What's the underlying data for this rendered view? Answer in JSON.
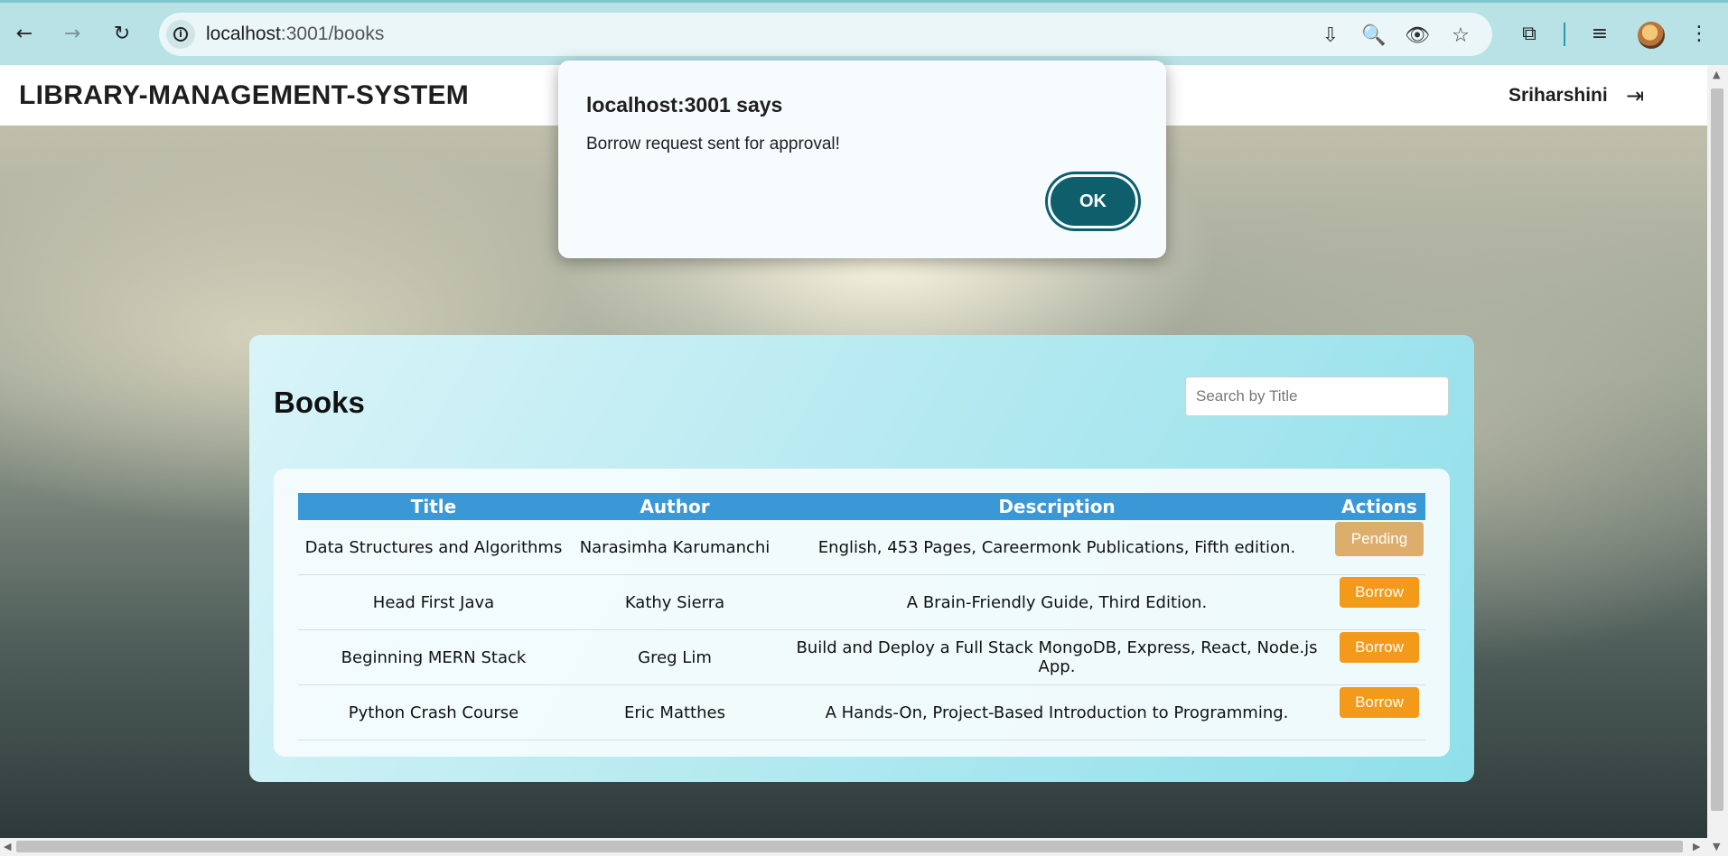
{
  "browser": {
    "url_host": "localhost",
    "url_path": ":3001/books",
    "icons": {
      "back": "←",
      "forward": "→",
      "reload": "↻",
      "install": "⇩",
      "zoom": "🔍",
      "eye": "👁",
      "star": "☆",
      "extensions": "⧉",
      "media": "≡",
      "menu": "⋮"
    }
  },
  "header": {
    "brand": "LIBRARY-MANAGEMENT-SYSTEM",
    "username": "Sriharshini",
    "logout_icon": "⇥"
  },
  "books": {
    "title": "Books",
    "search_placeholder": "Search by Title",
    "columns": [
      "Title",
      "Author",
      "Description",
      "Actions"
    ],
    "rows": [
      {
        "title": "Data Structures and Algorithms",
        "author": "Narasimha Karumanchi",
        "description": "English, 453 Pages, Careermonk Publications, Fifth edition.",
        "action": "Pending"
      },
      {
        "title": "Head First Java",
        "author": "Kathy Sierra",
        "description": "A Brain-Friendly Guide, Third Edition.",
        "action": "Borrow"
      },
      {
        "title": "Beginning MERN Stack",
        "author": "Greg Lim",
        "description": "Build and Deploy a Full Stack MongoDB, Express, React, Node.js App.",
        "action": "Borrow"
      },
      {
        "title": "Python Crash Course",
        "author": "Eric Matthes",
        "description": "A Hands-On, Project-Based Introduction to Programming.",
        "action": "Borrow"
      }
    ]
  },
  "dialog": {
    "title": "localhost:3001 says",
    "message": "Borrow request sent for approval!",
    "ok_label": "OK"
  },
  "colors": {
    "table_header": "#3a98d6",
    "borrow_button": "#f39a1b",
    "pending_button": "#ddae6b",
    "ok_button": "#0e5f6b"
  }
}
